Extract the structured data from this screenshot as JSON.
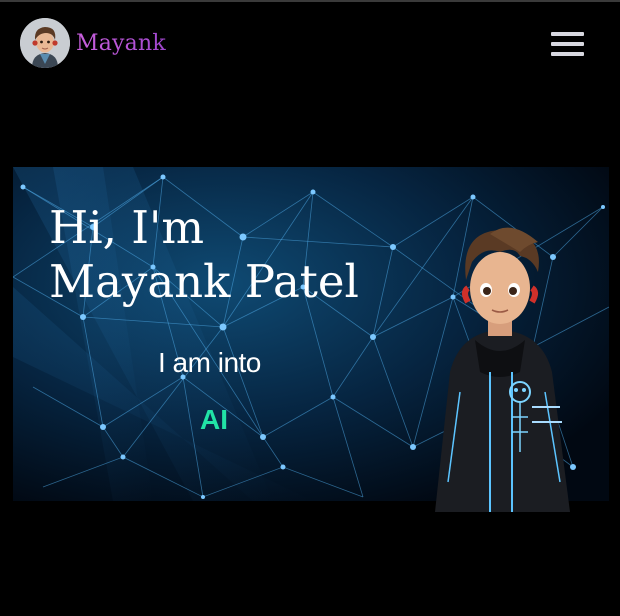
{
  "nav": {
    "brand_name": "Mayank",
    "menu_icon": "hamburger-menu-icon",
    "brand_gradient": [
      "#c85fdc",
      "#9e45cc"
    ]
  },
  "hero": {
    "title_line1": "Hi, I'm",
    "title_line2": "Mayank Patel",
    "intro": "I am into",
    "role": "AI",
    "role_color": "#21e3a6",
    "background": "network-lines-image",
    "character": "cartoon-boy-in-hoodie-image"
  }
}
